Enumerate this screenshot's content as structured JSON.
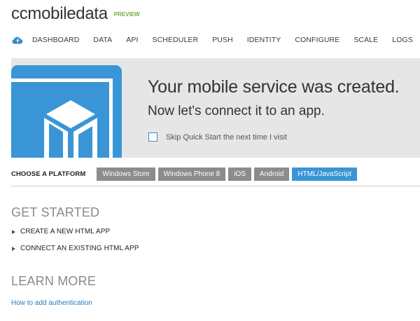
{
  "header": {
    "title": "ccmobiledata",
    "badge": "PREVIEW"
  },
  "nav": {
    "icon": "cloud-lightning-icon",
    "items": [
      "DASHBOARD",
      "DATA",
      "API",
      "SCHEDULER",
      "PUSH",
      "IDENTITY",
      "CONFIGURE",
      "SCALE",
      "LOGS"
    ]
  },
  "banner": {
    "art_icon": "mobile-device-cube-icon",
    "heading": "Your mobile service was created.",
    "subheading": "Now let's connect it to an app.",
    "skip_checkbox": {
      "label": "Skip Quick Start the next time I visit",
      "checked": false
    }
  },
  "platform": {
    "label": "CHOOSE A PLATFORM",
    "tabs": [
      "Windows Store",
      "Windows Phone 8",
      "iOS",
      "Android",
      "HTML/JavaScript"
    ],
    "selected": "HTML/JavaScript"
  },
  "get_started": {
    "title": "GET STARTED",
    "items": [
      "CREATE A NEW HTML APP",
      "CONNECT AN EXISTING HTML APP"
    ]
  },
  "learn_more": {
    "title": "LEARN MORE",
    "link": "How to add authentication"
  },
  "colors": {
    "accent": "#3a95d6",
    "badge": "#6fae3a",
    "banner_bg": "#e6e6e6",
    "inactive_tab": "#8c8c8c",
    "link": "#2a7ab8"
  }
}
